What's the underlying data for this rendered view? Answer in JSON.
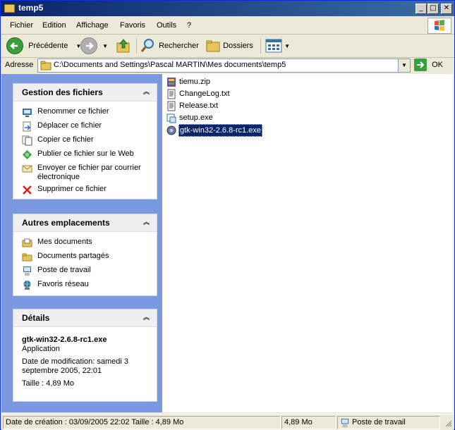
{
  "window": {
    "title": "temp5"
  },
  "menu": [
    "Fichier",
    "Edition",
    "Affichage",
    "Favoris",
    "Outils",
    "?"
  ],
  "toolbar": {
    "back_label": "Précédente",
    "search_label": "Rechercher",
    "folders_label": "Dossiers"
  },
  "address": {
    "label": "Adresse",
    "value": "C:\\Documents and Settings\\Pascal MARTIN\\Mes documents\\temp5",
    "go_label": "OK"
  },
  "panels": {
    "file_tasks": {
      "title": "Gestion des fichiers",
      "items": [
        {
          "label": "Renommer ce fichier",
          "icon": "rename-icon"
        },
        {
          "label": "Déplacer ce fichier",
          "icon": "move-icon"
        },
        {
          "label": "Copier ce fichier",
          "icon": "copy-icon"
        },
        {
          "label": "Publier ce fichier sur le Web",
          "icon": "publish-web-icon"
        },
        {
          "label": "Envoyer ce fichier par courrier électronique",
          "icon": "email-icon"
        },
        {
          "label": "Supprimer ce fichier",
          "icon": "delete-icon"
        }
      ]
    },
    "other_places": {
      "title": "Autres emplacements",
      "items": [
        {
          "label": "Mes documents",
          "icon": "my-documents-icon"
        },
        {
          "label": "Documents partagés",
          "icon": "shared-documents-icon"
        },
        {
          "label": "Poste de travail",
          "icon": "my-computer-icon"
        },
        {
          "label": "Favoris réseau",
          "icon": "network-places-icon"
        }
      ]
    },
    "details": {
      "title": "Détails",
      "file_name": "gtk-win32-2.6.8-rc1.exe",
      "file_type": "Application",
      "modified": "Date de modification: samedi 3 septembre 2005, 22:01",
      "size": "Taille : 4,89 Mo"
    }
  },
  "files": [
    {
      "name": "tiemu.zip",
      "icon": "zip-archive-icon",
      "selected": false
    },
    {
      "name": "ChangeLog.txt",
      "icon": "text-file-icon",
      "selected": false
    },
    {
      "name": "Release.txt",
      "icon": "text-file-icon",
      "selected": false
    },
    {
      "name": "setup.exe",
      "icon": "setup-exe-icon",
      "selected": false
    },
    {
      "name": "gtk-win32-2.6.8-rc1.exe",
      "icon": "gtk-exe-icon",
      "selected": true
    }
  ],
  "status": {
    "info": "Date de création : 03/09/2005 22:02 Taille  : 4,89 Mo",
    "size": "4,89 Mo",
    "zone": "Poste de travail"
  },
  "colors": {
    "title_bar": "#0a246a",
    "left_pane": "#7b99e1",
    "selection": "#0a246a"
  }
}
